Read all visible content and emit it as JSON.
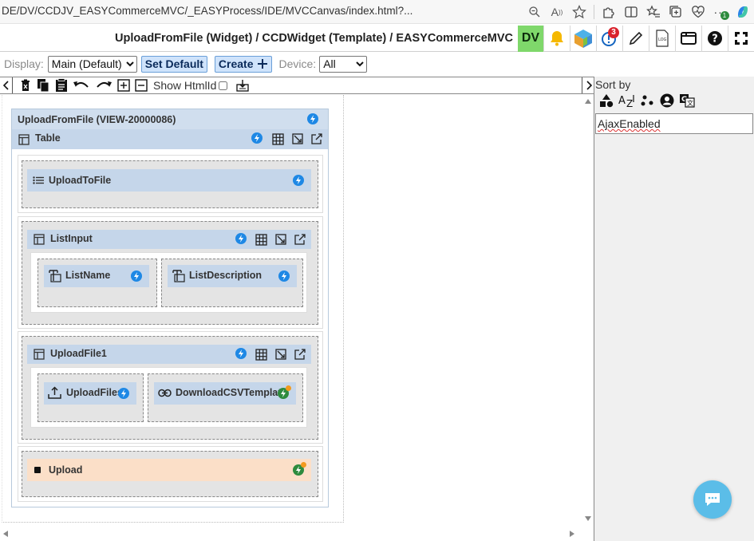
{
  "browser": {
    "url": "DE/DV/CCDJV_EASYCommerceMVC/_EASYProcess/IDE/MVCCanvas/index.html?...",
    "notification_badge": "1"
  },
  "header": {
    "title": "UploadFromFile (Widget) / CCDWidget (Template) / EASYCommerceMVC",
    "dv_label": "DV",
    "alert_badge": "3"
  },
  "display_bar": {
    "display_label": "Display:",
    "display_value": "Main (Default)",
    "set_default_label": "Set Default",
    "create_label": "Create",
    "device_label": "Device:",
    "device_value": "All"
  },
  "toolbar": {
    "show_htmlid_label": "Show HtmlId"
  },
  "right_panel": {
    "sort_by_label": "Sort by",
    "property_value": "AjaxEnabled"
  },
  "canvas": {
    "view_title": "UploadFromFile (VIEW-20000086)",
    "table_label": "Table",
    "upload_to_file_label": "UploadToFile",
    "list_input_label": "ListInput",
    "list_name_label": "ListName",
    "list_description_label": "ListDescription",
    "upload_file1_label": "UploadFile1",
    "upload_files_label": "UploadFiles",
    "download_csv_label": "DownloadCSVTemplate",
    "upload_label": "Upload"
  },
  "colors": {
    "bar_blue": "#c5d6ea",
    "bolt_blue": "#1e88e5",
    "bolt_green": "#2e8b3e",
    "upload_peach": "#fbdfc8",
    "dv_green": "#7fd86b",
    "chat_blue": "#5bbde8"
  }
}
